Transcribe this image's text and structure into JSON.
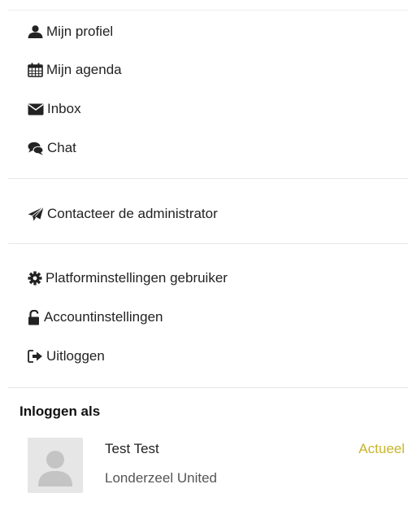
{
  "menu": {
    "profile": "Mijn profiel",
    "agenda": "Mijn agenda",
    "inbox": "Inbox",
    "chat": "Chat",
    "contact_admin": "Contacteer de administrator",
    "platform_settings": "Platforminstellingen gebruiker",
    "account_settings": "Accountinstellingen",
    "logout": "Uitloggen"
  },
  "login_as": {
    "title": "Inloggen als",
    "user": {
      "name": "Test Test",
      "organization": "Londerzeel United",
      "status": "Actueel",
      "status_color": "#c9b52a"
    }
  },
  "icons": [
    "user-icon",
    "calendar-icon",
    "envelope-icon",
    "chat-icon",
    "paper-plane-icon",
    "gear-icon",
    "unlock-icon",
    "sign-out-icon"
  ]
}
